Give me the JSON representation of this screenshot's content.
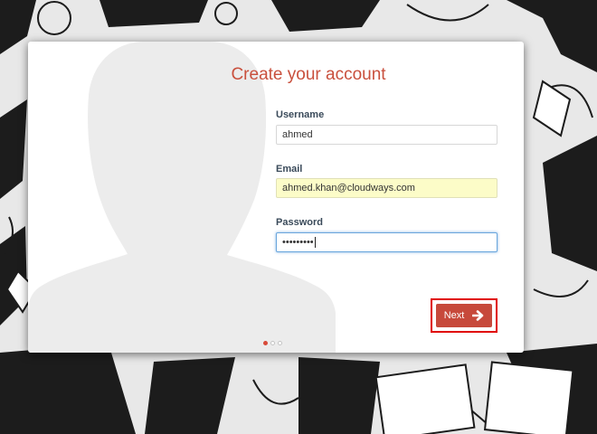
{
  "form": {
    "title": "Create your account",
    "username": {
      "label": "Username",
      "value": "ahmed"
    },
    "email": {
      "label": "Email",
      "value": "ahmed.khan@cloudways.com"
    },
    "password": {
      "label": "Password",
      "masked_value": "•••••••••"
    },
    "next_label": "Next"
  },
  "steps": {
    "count": 3,
    "active": 1
  },
  "colors": {
    "accent": "#c9503d",
    "button": "#c7493b",
    "highlight_border": "#e00000",
    "autofill_bg": "#fcfcc8"
  },
  "icons": {
    "next": "arrow-right-icon",
    "avatar": "person-silhouette"
  }
}
